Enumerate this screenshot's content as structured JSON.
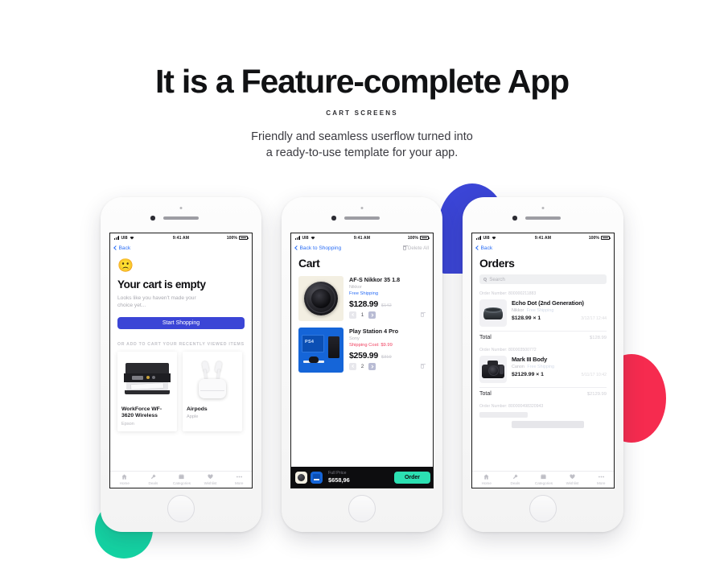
{
  "header": {
    "headline": "It is a Feature-complete App",
    "kicker": "CART SCREENS",
    "subtitle_line1": "Friendly and seamless userflow turned into",
    "subtitle_line2": "a ready-to-use template for your app."
  },
  "colors": {
    "accent_blue": "#3b45d6",
    "link_blue": "#2a6df5",
    "teal": "#14d3a3",
    "red": "#f62b4f",
    "order_green": "#2ce0b2"
  },
  "status_bar": {
    "carrier": "UI8",
    "time": "9:41 AM",
    "battery": "100%"
  },
  "tab_bar": {
    "items": [
      {
        "label": "Home",
        "icon": "home-icon"
      },
      {
        "label": "Deals",
        "icon": "hammer-icon"
      },
      {
        "label": "Categories",
        "icon": "grid-box-icon"
      },
      {
        "label": "Wishlist",
        "icon": "heart-icon"
      },
      {
        "label": "More",
        "icon": "ellipsis-icon"
      }
    ]
  },
  "screen1": {
    "back_label": "Back",
    "emoji": "☹",
    "title": "Your cart is empty",
    "subtitle": "Looks like you haven't made your choice yet...",
    "cta_label": "Start Shopping",
    "recently_viewed_label": "OR ADD TO CART YOUR  RECENTLY VIEWED ITEMS",
    "products": [
      {
        "name": "WorkForce WF-3620 Wireless",
        "brand": "Epson",
        "art": "printer-illustration"
      },
      {
        "name": "Airpods",
        "brand": "Apple",
        "art": "airpods-illustration"
      }
    ]
  },
  "screen2": {
    "back_label": "Back to Shopping",
    "delete_all_label": "Delete All",
    "title": "Cart",
    "items": [
      {
        "name": "AF-S Nikkor 35 1.8",
        "brand": "Nikkor",
        "shipping": "Free Shipping",
        "shipping_type": "free",
        "price": "$128.99",
        "old_price": "$142",
        "qty": "1",
        "art": "camera-lens-illustration"
      },
      {
        "name": "Play Station 4 Pro",
        "brand": "Sony",
        "shipping": "Shipping Cost: $9.99",
        "shipping_type": "paid",
        "price": "$259.99",
        "old_price": "$319",
        "qty": "2",
        "art": "playstation-illustration"
      }
    ],
    "checkout": {
      "label": "Full Price",
      "total": "$658,96",
      "button": "Order"
    }
  },
  "screen3": {
    "back_label": "Back",
    "title": "Orders",
    "search_placeholder": "Search",
    "orders": [
      {
        "order_number": "Order Number: 800000211883",
        "name": "Echo Dot (2nd Generation)",
        "brand": "Nikkor",
        "shipping": "Free Shipping",
        "qty_price": "$128.99 × 1",
        "date": "3/12/17 12:44",
        "total_label": "Total",
        "total_value": "$128.99",
        "art": "echo-dot-illustration"
      },
      {
        "order_number": "Order Number: 800003500772",
        "name": "Mark III Body",
        "brand": "Canon",
        "shipping": "Free Shipping",
        "qty_price": "$2129.99 × 1",
        "date": "5/11/17 10:42",
        "total_label": "Total",
        "total_value": "$2129.99",
        "art": "dslr-camera-illustration"
      },
      {
        "order_number": "Order Number: 800000498320943",
        "name": "",
        "brand": "",
        "shipping": "",
        "qty_price": "",
        "date": "",
        "total_label": "",
        "total_value": "",
        "art": ""
      }
    ]
  }
}
